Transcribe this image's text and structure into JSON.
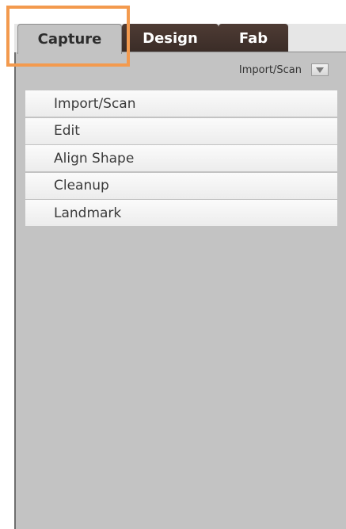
{
  "tabs": [
    {
      "label": "Capture",
      "active": true
    },
    {
      "label": "Design",
      "active": false
    },
    {
      "label": "Fab",
      "active": false
    }
  ],
  "dropdown": {
    "selected": "Import/Scan",
    "icon": "chevron-down-icon"
  },
  "menu": {
    "items": [
      {
        "label": "Import/Scan"
      },
      {
        "label": "Edit"
      },
      {
        "label": "Align Shape"
      },
      {
        "label": "Cleanup"
      },
      {
        "label": "Landmark"
      }
    ]
  },
  "colors": {
    "tab_inactive": "#3f302b",
    "panel": "#c3c3c3",
    "highlight": "#f39a4e",
    "menu_item": "#f4f4f4"
  }
}
